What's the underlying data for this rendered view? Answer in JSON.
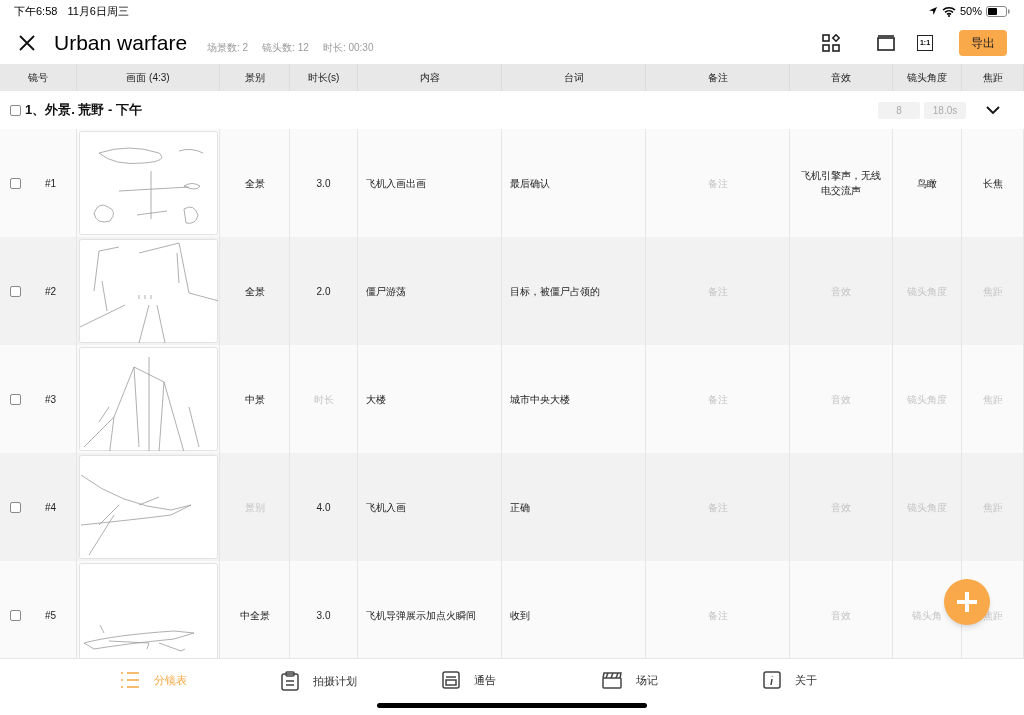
{
  "status_bar": {
    "time": "下午6:58",
    "date": "11月6日周三",
    "battery": "50%"
  },
  "header": {
    "title": "Urban warfare",
    "stats": [
      "场景数: 2",
      "镜头数: 12",
      "时长: 00:30"
    ],
    "export_button": "导出",
    "ratio_icon": "1:1"
  },
  "table": {
    "columns": [
      "镜号",
      "画面 (4:3)",
      "景别",
      "时长(s)",
      "内容",
      "台词",
      "备注",
      "音效",
      "镜头角度",
      "焦距"
    ],
    "scene": {
      "title": "1、外景. 荒野 - 下午",
      "checked": false,
      "shots": "8",
      "duration": "18.0s",
      "expanded": true
    },
    "rows": [
      {
        "checked": false,
        "cells": [
          {
            "value": "#1"
          },
          {
            "kind": "picture"
          },
          {
            "value": "全景"
          },
          {
            "value": "3.0"
          },
          {
            "value": "飞机入画出画"
          },
          {
            "value": "最后确认"
          },
          {
            "placeholder": "备注"
          },
          {
            "value": "飞机引擎声，无线电交流声"
          },
          {
            "value": "鸟瞰"
          },
          {
            "value": "长焦"
          }
        ]
      },
      {
        "checked": false,
        "cells": [
          {
            "value": "#2"
          },
          {
            "kind": "picture"
          },
          {
            "value": "全景"
          },
          {
            "value": "2.0"
          },
          {
            "value": "僵尸游荡"
          },
          {
            "value": "目标，被僵尸占领的"
          },
          {
            "placeholder": "备注"
          },
          {
            "placeholder": "音效"
          },
          {
            "placeholder": "镜头角度"
          },
          {
            "placeholder": "焦距"
          }
        ]
      },
      {
        "checked": false,
        "cells": [
          {
            "value": "#3"
          },
          {
            "kind": "picture"
          },
          {
            "value": "中景"
          },
          {
            "placeholder": "时长"
          },
          {
            "value": "大楼"
          },
          {
            "value": "城市中央大楼"
          },
          {
            "placeholder": "备注"
          },
          {
            "placeholder": "音效"
          },
          {
            "placeholder": "镜头角度"
          },
          {
            "placeholder": "焦距"
          }
        ]
      },
      {
        "checked": false,
        "cells": [
          {
            "value": "#4"
          },
          {
            "kind": "picture"
          },
          {
            "placeholder": "景别"
          },
          {
            "value": "4.0"
          },
          {
            "value": "飞机入画"
          },
          {
            "value": "正确"
          },
          {
            "placeholder": "备注"
          },
          {
            "placeholder": "音效"
          },
          {
            "placeholder": "镜头角度"
          },
          {
            "placeholder": "焦距"
          }
        ]
      },
      {
        "checked": false,
        "cells": [
          {
            "value": "#5"
          },
          {
            "kind": "picture"
          },
          {
            "value": "中全景"
          },
          {
            "value": "3.0"
          },
          {
            "value": "飞机导弹展示加点火瞬间"
          },
          {
            "value": "收到"
          },
          {
            "placeholder": "备注"
          },
          {
            "placeholder": "音效"
          },
          {
            "placeholder": "镜头角"
          },
          {
            "placeholder": "焦距"
          }
        ]
      }
    ]
  },
  "tabs": [
    {
      "label": "分镜表",
      "selected": true
    },
    {
      "label": "拍摄计划",
      "selected": false
    },
    {
      "label": "通告",
      "selected": false
    },
    {
      "label": "场记",
      "selected": false
    },
    {
      "label": "关于",
      "selected": false
    }
  ]
}
